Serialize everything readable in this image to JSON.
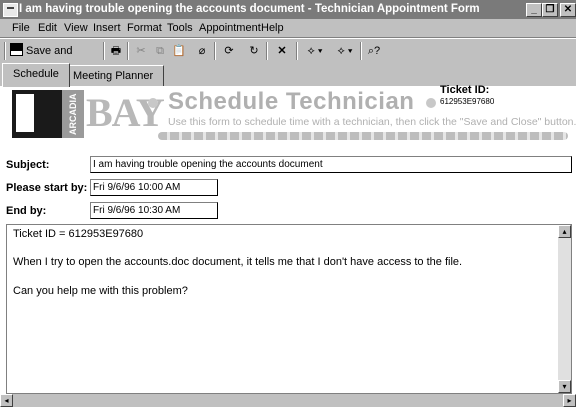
{
  "window": {
    "title": "I am having trouble opening the accounts document - Technician Appointment Form",
    "minimize_label": "_",
    "restore_label": "❐",
    "close_label": "✕"
  },
  "menu": {
    "items": [
      "File",
      "Edit",
      "View",
      "Insert",
      "Format",
      "Tools",
      "Appointment",
      "Help"
    ]
  },
  "toolbar": {
    "save_close_label": "Save and Close",
    "icons": [
      "save-icon",
      "print-icon",
      "cut-icon",
      "copy-icon",
      "paste-icon",
      "attach-icon",
      "recurrence-icon",
      "refresh-icon",
      "delete-icon",
      "previous-icon",
      "next-icon",
      "help-icon"
    ]
  },
  "tabs": [
    "Schedule",
    "Meeting Planner"
  ],
  "banner": {
    "logo_text": "BAY",
    "logo_strip": "ARCADIA",
    "title": "Schedule Technician",
    "subtitle": "Use this form to schedule time with a technician, then click the \"Save and Close\" button.",
    "ticket_label": "Ticket ID:",
    "ticket_value": "612953E97680"
  },
  "form": {
    "subject_label": "Subject:",
    "subject_value": "I am having trouble opening the accounts document",
    "start_label": "Please start by:",
    "start_value": "Fri 9/6/96 10:00 AM",
    "end_label": "End by:",
    "end_value": "Fri 9/6/96 10:30 AM"
  },
  "body": {
    "line1": "Ticket ID = 612953E97680",
    "line2": "When I try to open the accounts.doc document, it tells me that I don't have access to the file.",
    "line3": "Can you help me with this problem?"
  }
}
